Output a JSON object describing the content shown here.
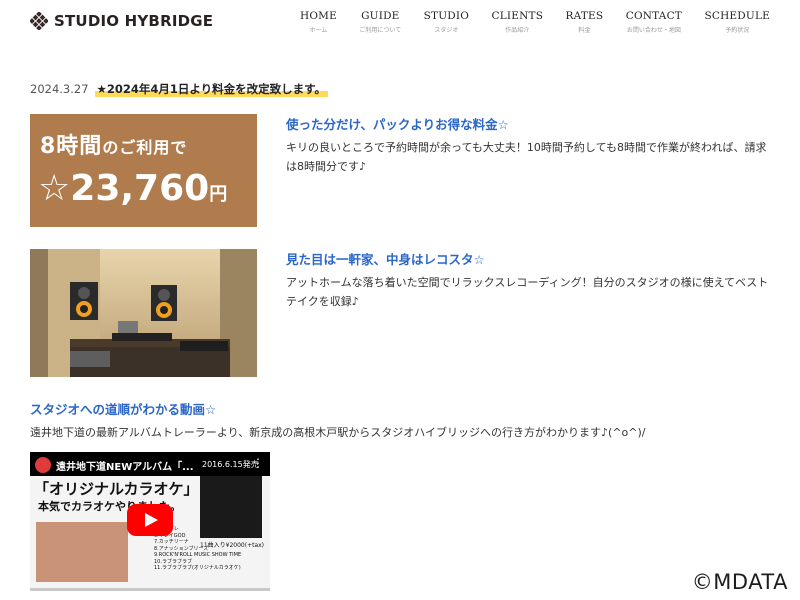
{
  "header": {
    "logo_text": "STUDIO HYBRIDGE",
    "nav": [
      {
        "en": "HOME",
        "jp": "ホーム"
      },
      {
        "en": "GUIDE",
        "jp": "ご利用について"
      },
      {
        "en": "STUDIO",
        "jp": "スタジオ"
      },
      {
        "en": "CLIENTS",
        "jp": "作品紹介"
      },
      {
        "en": "RATES",
        "jp": "料金"
      },
      {
        "en": "CONTACT",
        "jp": "お問い合わせ・地図"
      },
      {
        "en": "SCHEDULE",
        "jp": "予約状況"
      }
    ]
  },
  "news": {
    "date": "2024.3.27",
    "title": "★2024年4月1日より料金を改定致します。"
  },
  "features": [
    {
      "image": {
        "line1": "8時間",
        "line1_small": "のご利用で",
        "line2": "☆23,760",
        "line2_unit": "円"
      },
      "title": "使った分だけ、パックよりお得な料金☆",
      "desc": "キリの良いところで予約時間が余っても大丈夫！10時間予約しても8時間で作業が終われば、請求は8時間分です♪"
    },
    {
      "title": "見た目は一軒家、中身はレコスタ☆",
      "desc": "アットホームな落ち着いた空間でリラックスレコーディング！自分のスタジオの様に使えてベストテイクを収録♪"
    }
  ],
  "video_section": {
    "title": "スタジオへの道順がわかる動画☆",
    "desc": "遠井地下道の最新アルバムトレーラーより、新京成の高根木戸駅からスタジオハイブリッジへの行き方がわかります♪(^o^)/",
    "video": {
      "overlay_title": "遠井地下道NEWアルバム「...",
      "date": "2016.6.15発売",
      "headline": "「オリジナルカラオケ」",
      "subheadline": "本気でカラオケやりました。",
      "price": "11曲入り¥2000(+tax)",
      "tracks": [
        "5.紫ナガレ",
        "6.キレイGOD",
        "7.カッチリーナ",
        "8.アナッションブリーズ",
        "9.ROCK'N'ROLL MUSIC SHOW TIME",
        "10.ラブラブラブ",
        "11.ラブラブラブ(オリジナルカラオケ)"
      ]
    }
  },
  "watermark": "©MDATA"
}
